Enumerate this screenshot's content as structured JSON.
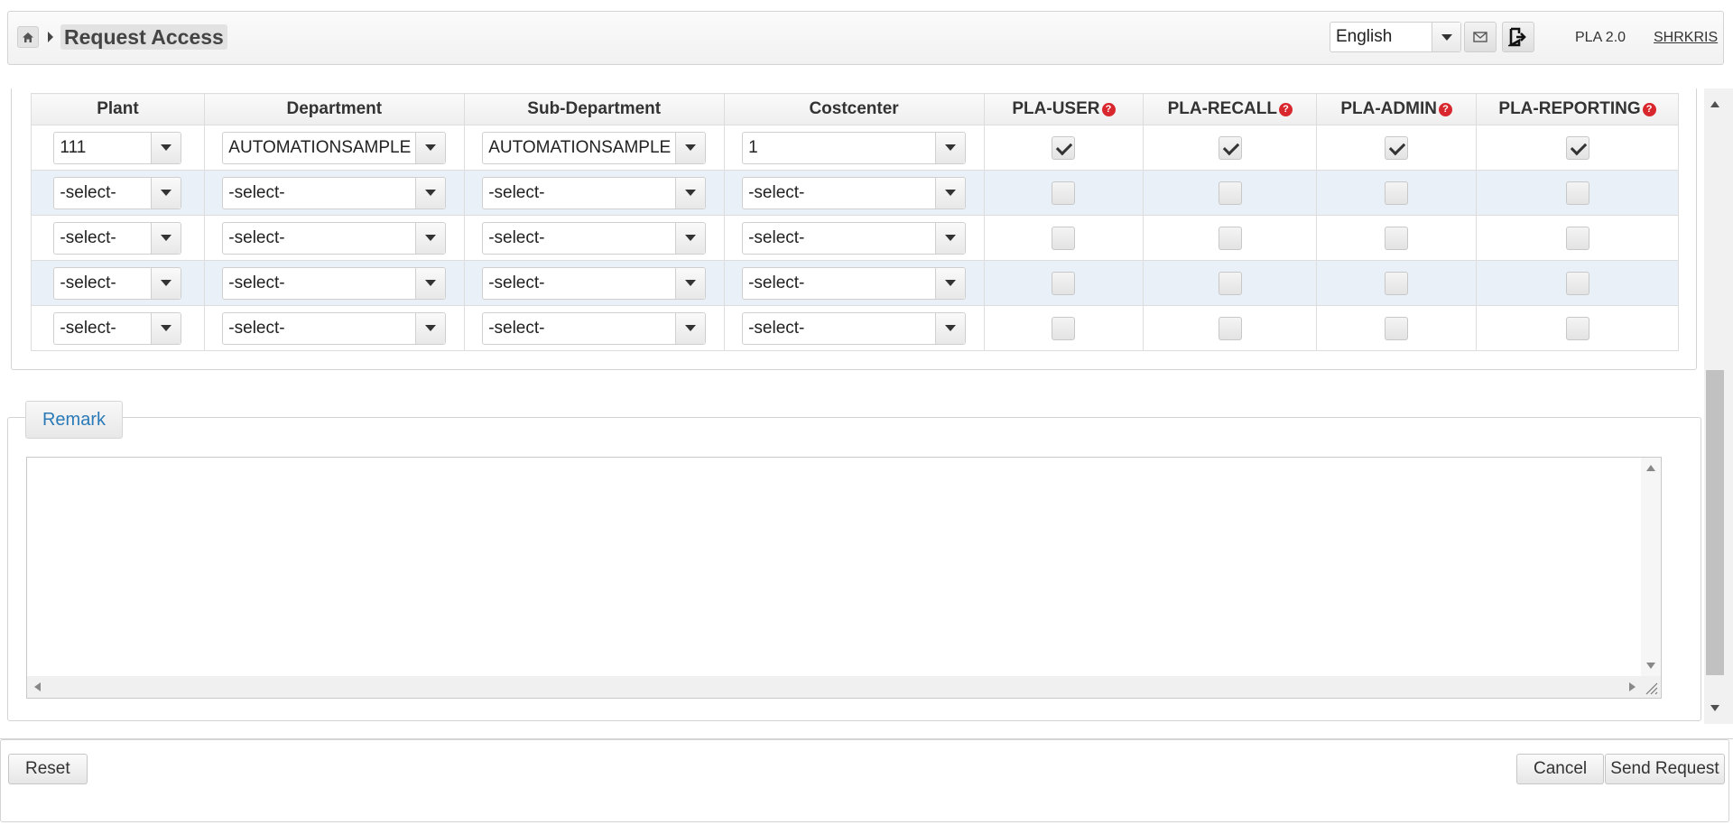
{
  "header": {
    "title": "Request Access",
    "language": "English",
    "version": "PLA 2.0",
    "user": "SHRKRIS",
    "icons": {
      "home": "home-icon",
      "mail": "mail-icon",
      "logout": "logout-icon"
    }
  },
  "grid": {
    "columns": [
      "Plant",
      "Department",
      "Sub-Department",
      "Costcenter",
      "PLA-USER",
      "PLA-RECALL",
      "PLA-ADMIN",
      "PLA-REPORTING"
    ],
    "rows": [
      {
        "plant": "111",
        "department": "AUTOMATIONSAMPLE",
        "sub_department": "AUTOMATIONSAMPLE",
        "costcenter": "1",
        "checks": [
          true,
          true,
          true,
          true
        ]
      },
      {
        "plant": "-select-",
        "department": "-select-",
        "sub_department": "-select-",
        "costcenter": "-select-",
        "checks": [
          false,
          false,
          false,
          false
        ]
      },
      {
        "plant": "-select-",
        "department": "-select-",
        "sub_department": "-select-",
        "costcenter": "-select-",
        "checks": [
          false,
          false,
          false,
          false
        ]
      },
      {
        "plant": "-select-",
        "department": "-select-",
        "sub_department": "-select-",
        "costcenter": "-select-",
        "checks": [
          false,
          false,
          false,
          false
        ]
      },
      {
        "plant": "-select-",
        "department": "-select-",
        "sub_department": "-select-",
        "costcenter": "-select-",
        "checks": [
          false,
          false,
          false,
          false
        ]
      }
    ]
  },
  "remark": {
    "label": "Remark",
    "value": ""
  },
  "footer": {
    "reset": "Reset",
    "cancel": "Cancel",
    "send": "Send Request"
  },
  "colors": {
    "accent_link": "#2a7ab8",
    "help_icon": "#d9272e",
    "row_alt": "#e9f0f8"
  }
}
